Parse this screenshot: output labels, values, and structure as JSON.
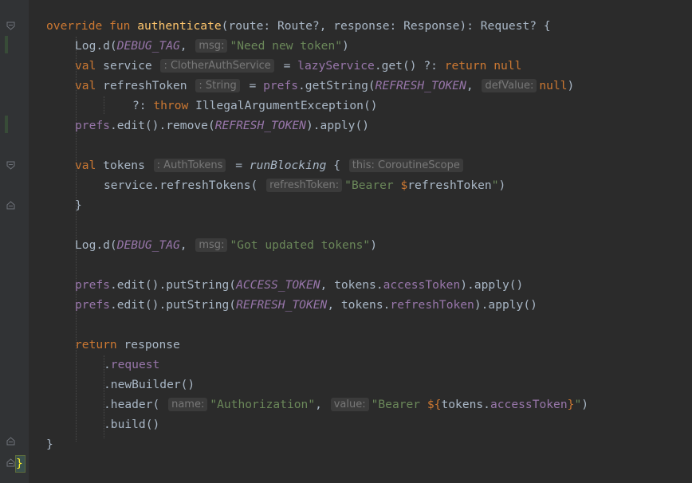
{
  "editor": {
    "lines": [
      {
        "id": "l1",
        "tokens": [
          {
            "t": "override ",
            "c": "kw"
          },
          {
            "t": "fun ",
            "c": "kw"
          },
          {
            "t": "authenticate",
            "c": "fn"
          },
          {
            "t": "(route: Route?, response: Response): Request? {"
          }
        ]
      },
      {
        "id": "l2",
        "tokens": [
          {
            "t": "Log.d("
          },
          {
            "t": "DEBUG_TAG",
            "c": "cn"
          },
          {
            "t": ", "
          },
          {
            "hint": "msg:"
          },
          {
            "t": "\"Need new token\"",
            "c": "st"
          },
          {
            "t": ")"
          }
        ]
      },
      {
        "id": "l3",
        "tokens": [
          {
            "t": "val ",
            "c": "kw"
          },
          {
            "t": "service "
          },
          {
            "hint": ": ClotherAuthService"
          },
          {
            "t": " = "
          },
          {
            "t": "lazyService",
            "c": "pr"
          },
          {
            "t": ".get() ?: "
          },
          {
            "t": "return null",
            "c": "kw"
          }
        ]
      },
      {
        "id": "l4",
        "tokens": [
          {
            "t": "val ",
            "c": "kw"
          },
          {
            "t": "refreshToken "
          },
          {
            "hint": ": String"
          },
          {
            "t": " = "
          },
          {
            "t": "prefs",
            "c": "pr"
          },
          {
            "t": ".getString("
          },
          {
            "t": "REFRESH_TOKEN",
            "c": "cn"
          },
          {
            "t": ", "
          },
          {
            "hint": "defValue:"
          },
          {
            "t": "null",
            "c": "kw"
          },
          {
            "t": ")"
          }
        ]
      },
      {
        "id": "l5",
        "tokens": [
          {
            "t": "?: "
          },
          {
            "t": "throw ",
            "c": "kw"
          },
          {
            "t": "IllegalArgumentException()"
          }
        ]
      },
      {
        "id": "l6",
        "tokens": [
          {
            "t": "prefs",
            "c": "pr"
          },
          {
            "t": ".edit().remove("
          },
          {
            "t": "REFRESH_TOKEN",
            "c": "cn"
          },
          {
            "t": ").apply()"
          }
        ]
      },
      {
        "id": "l7",
        "tokens": [
          {
            "t": "val ",
            "c": "kw"
          },
          {
            "t": "tokens "
          },
          {
            "hint": ": AuthTokens"
          },
          {
            "t": " = "
          },
          {
            "t": "runBlocking",
            "c": "it"
          },
          {
            "t": " { "
          },
          {
            "hint": "this: CoroutineScope"
          }
        ]
      },
      {
        "id": "l8",
        "tokens": [
          {
            "t": "service.refreshTokens( "
          },
          {
            "hint": "refreshToken:"
          },
          {
            "t": "\"Bearer ",
            "c": "st"
          },
          {
            "t": "$",
            "c": "kw"
          },
          {
            "t": "refreshToken"
          },
          {
            "t": "\"",
            "c": "st"
          },
          {
            "t": ")"
          }
        ]
      },
      {
        "id": "l9",
        "tokens": [
          {
            "t": "}"
          }
        ]
      },
      {
        "id": "l10",
        "tokens": [
          {
            "t": "Log.d("
          },
          {
            "t": "DEBUG_TAG",
            "c": "cn"
          },
          {
            "t": ", "
          },
          {
            "hint": "msg:"
          },
          {
            "t": "\"Got updated tokens\"",
            "c": "st"
          },
          {
            "t": ")"
          }
        ]
      },
      {
        "id": "l11",
        "tokens": [
          {
            "t": "prefs",
            "c": "pr"
          },
          {
            "t": ".edit().putString("
          },
          {
            "t": "ACCESS_TOKEN",
            "c": "cn"
          },
          {
            "t": ", tokens."
          },
          {
            "t": "accessToken",
            "c": "pr"
          },
          {
            "t": ").apply()"
          }
        ]
      },
      {
        "id": "l12",
        "tokens": [
          {
            "t": "prefs",
            "c": "pr"
          },
          {
            "t": ".edit().putString("
          },
          {
            "t": "REFRESH_TOKEN",
            "c": "cn"
          },
          {
            "t": ", tokens."
          },
          {
            "t": "refreshToken",
            "c": "pr"
          },
          {
            "t": ").apply()"
          }
        ]
      },
      {
        "id": "l13",
        "tokens": [
          {
            "t": "return ",
            "c": "kw"
          },
          {
            "t": "response"
          }
        ]
      },
      {
        "id": "l14",
        "tokens": [
          {
            "t": "."
          },
          {
            "t": "request",
            "c": "pr"
          }
        ]
      },
      {
        "id": "l15",
        "tokens": [
          {
            "t": ".newBuilder()"
          }
        ]
      },
      {
        "id": "l16",
        "tokens": [
          {
            "t": ".header( "
          },
          {
            "hint": "name:"
          },
          {
            "t": "\"Authorization\"",
            "c": "st"
          },
          {
            "t": ", "
          },
          {
            "hint": "value:"
          },
          {
            "t": "\"Bearer ",
            "c": "st"
          },
          {
            "t": "${",
            "c": "kw"
          },
          {
            "t": "tokens."
          },
          {
            "t": "accessToken",
            "c": "pr"
          },
          {
            "t": "}",
            "c": "kw"
          },
          {
            "t": "\"",
            "c": "st"
          },
          {
            "t": ")"
          }
        ]
      },
      {
        "id": "l17",
        "tokens": [
          {
            "t": ".build()"
          }
        ]
      },
      {
        "id": "l18",
        "tokens": [
          {
            "t": "}"
          }
        ]
      }
    ],
    "closing_brace": "}",
    "colors": {
      "background": "#2b2b2b",
      "gutter": "#313335",
      "keyword": "#cc7832",
      "function": "#ffc66d",
      "property": "#9876aa",
      "string": "#6a8759",
      "text": "#a9b7c6",
      "hint_bg": "#3b3b3b",
      "hint_text": "#787878",
      "brace_match": "#ffef28"
    }
  }
}
